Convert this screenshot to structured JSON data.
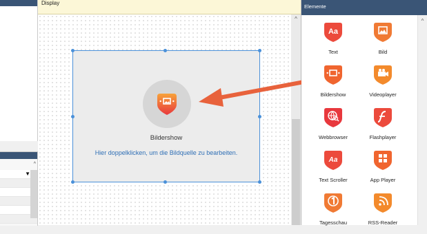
{
  "display": {
    "title": "Display",
    "widget": {
      "name": "Bildershow",
      "hint": "Hier doppelklicken, um die Bildquelle zu bearbeiten."
    }
  },
  "elements_panel": {
    "title": "Elemente",
    "items": [
      {
        "label": "Text",
        "icon": "text-icon"
      },
      {
        "label": "Bild",
        "icon": "image-icon"
      },
      {
        "label": "Bildershow",
        "icon": "slideshow-icon"
      },
      {
        "label": "Videoplayer",
        "icon": "video-camera-icon"
      },
      {
        "label": "Webbrowser",
        "icon": "globe-icon"
      },
      {
        "label": "Flashplayer",
        "icon": "flash-icon"
      },
      {
        "label": "Text Scroller",
        "icon": "text-scroller-icon"
      },
      {
        "label": "App Player",
        "icon": "app-grid-icon"
      },
      {
        "label": "Tagesschau",
        "icon": "tagesschau-icon"
      },
      {
        "label": "RSS-Reader",
        "icon": "rss-icon"
      }
    ]
  },
  "colors": {
    "accent_orange": "#f0652f",
    "accent_red": "#e8383d",
    "selection_blue": "#4a90d9",
    "header_navy": "#3a5576"
  }
}
